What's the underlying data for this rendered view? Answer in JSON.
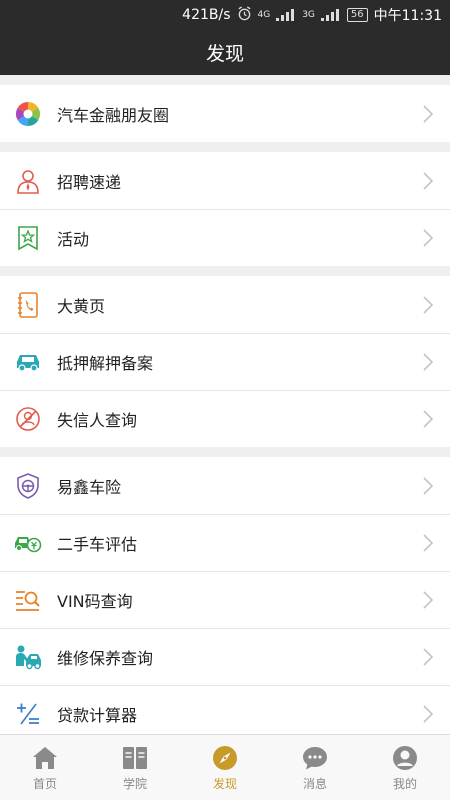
{
  "status_bar": {
    "speed": "421B/s",
    "net_top": "4G",
    "net_3g": "3G",
    "battery": "56",
    "time": "中午11:31"
  },
  "header": {
    "title": "发现"
  },
  "groups": [
    {
      "items": [
        {
          "label": "汽车金融朋友圈",
          "icon": "aperture-icon"
        }
      ]
    },
    {
      "items": [
        {
          "label": "招聘速递",
          "icon": "recruit-person-icon"
        },
        {
          "label": "活动",
          "icon": "star-flag-icon"
        }
      ]
    },
    {
      "items": [
        {
          "label": "大黄页",
          "icon": "phone-book-icon"
        },
        {
          "label": "抵押解押备案",
          "icon": "car-icon"
        },
        {
          "label": "失信人查询",
          "icon": "no-person-icon"
        }
      ]
    },
    {
      "items": [
        {
          "label": "易鑫车险",
          "icon": "shield-steering-icon"
        },
        {
          "label": "二手车评估",
          "icon": "car-valuation-icon"
        },
        {
          "label": "VIN码查询",
          "icon": "vin-search-icon"
        },
        {
          "label": "维修保养查询",
          "icon": "repair-icon"
        },
        {
          "label": "贷款计算器",
          "icon": "calculator-icon"
        }
      ]
    }
  ],
  "tabs": [
    {
      "label": "首页",
      "icon": "home-icon",
      "active": false
    },
    {
      "label": "学院",
      "icon": "book-icon",
      "active": false
    },
    {
      "label": "发现",
      "icon": "compass-icon",
      "active": true
    },
    {
      "label": "消息",
      "icon": "chat-icon",
      "active": false
    },
    {
      "label": "我的",
      "icon": "user-icon",
      "active": false
    }
  ],
  "colors": {
    "bar": "#2b2b2b",
    "accent": "#c79a2a",
    "red": "#e25b4b",
    "green": "#3aa84a",
    "orange": "#e8822a",
    "teal": "#2aa9b5",
    "purple": "#7a5bb0"
  }
}
